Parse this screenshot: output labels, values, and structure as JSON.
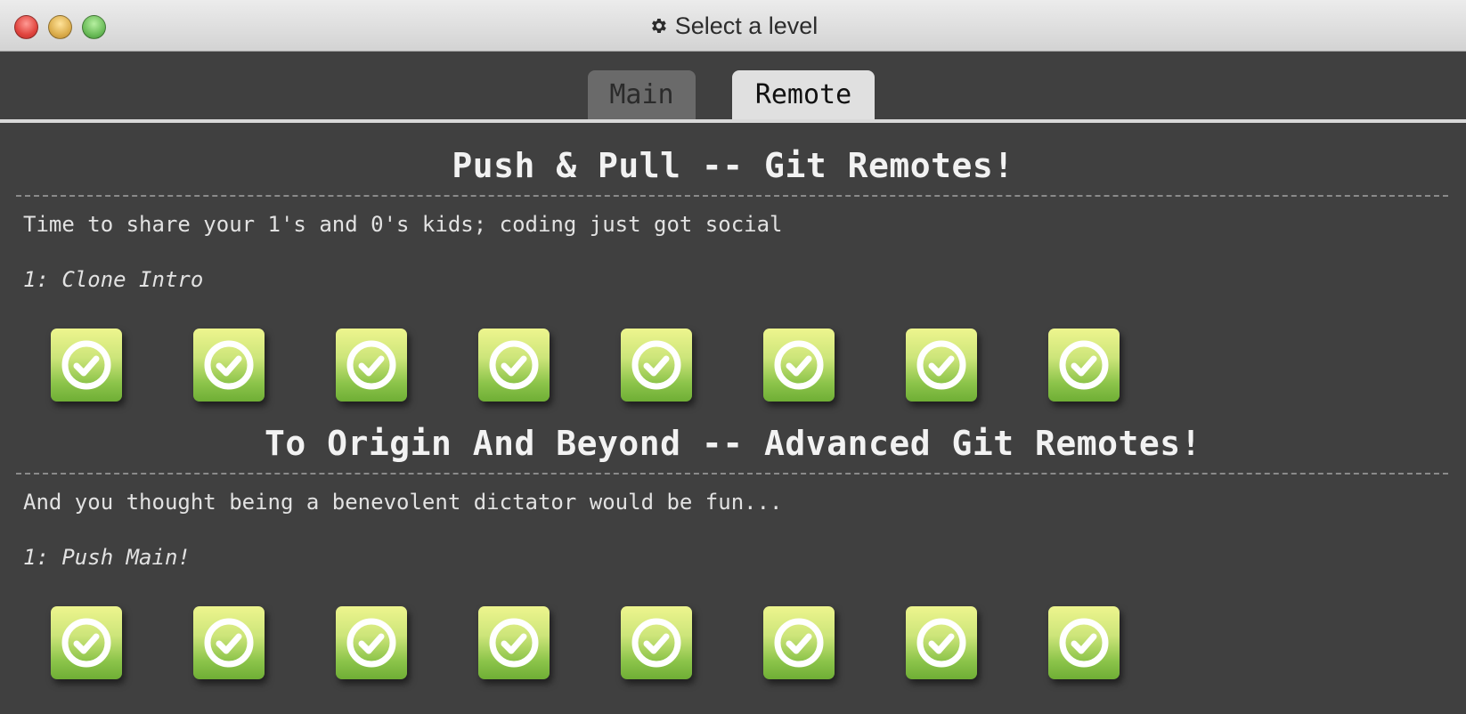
{
  "window": {
    "title": "Select a level",
    "title_icon": "gear-icon"
  },
  "tabs": [
    {
      "label": "Main",
      "selected": false
    },
    {
      "label": "Remote",
      "selected": true
    }
  ],
  "sections": [
    {
      "title": "Push & Pull -- Git Remotes!",
      "description": "Time to share your 1's and 0's kids; coding just got social",
      "current_level": "1: Clone Intro",
      "levels_completed": [
        true,
        true,
        true,
        true,
        true,
        true,
        true,
        true
      ]
    },
    {
      "title": "To Origin And Beyond -- Advanced Git Remotes!",
      "description": "And you thought being a benevolent dictator would be fun...",
      "current_level": "1: Push Main!",
      "levels_completed": [
        true,
        true,
        true,
        true,
        true,
        true,
        true,
        true
      ]
    }
  ],
  "colors": {
    "background": "#404040",
    "level_complete_top": "#eef58e",
    "level_complete_bottom": "#6fae35"
  }
}
